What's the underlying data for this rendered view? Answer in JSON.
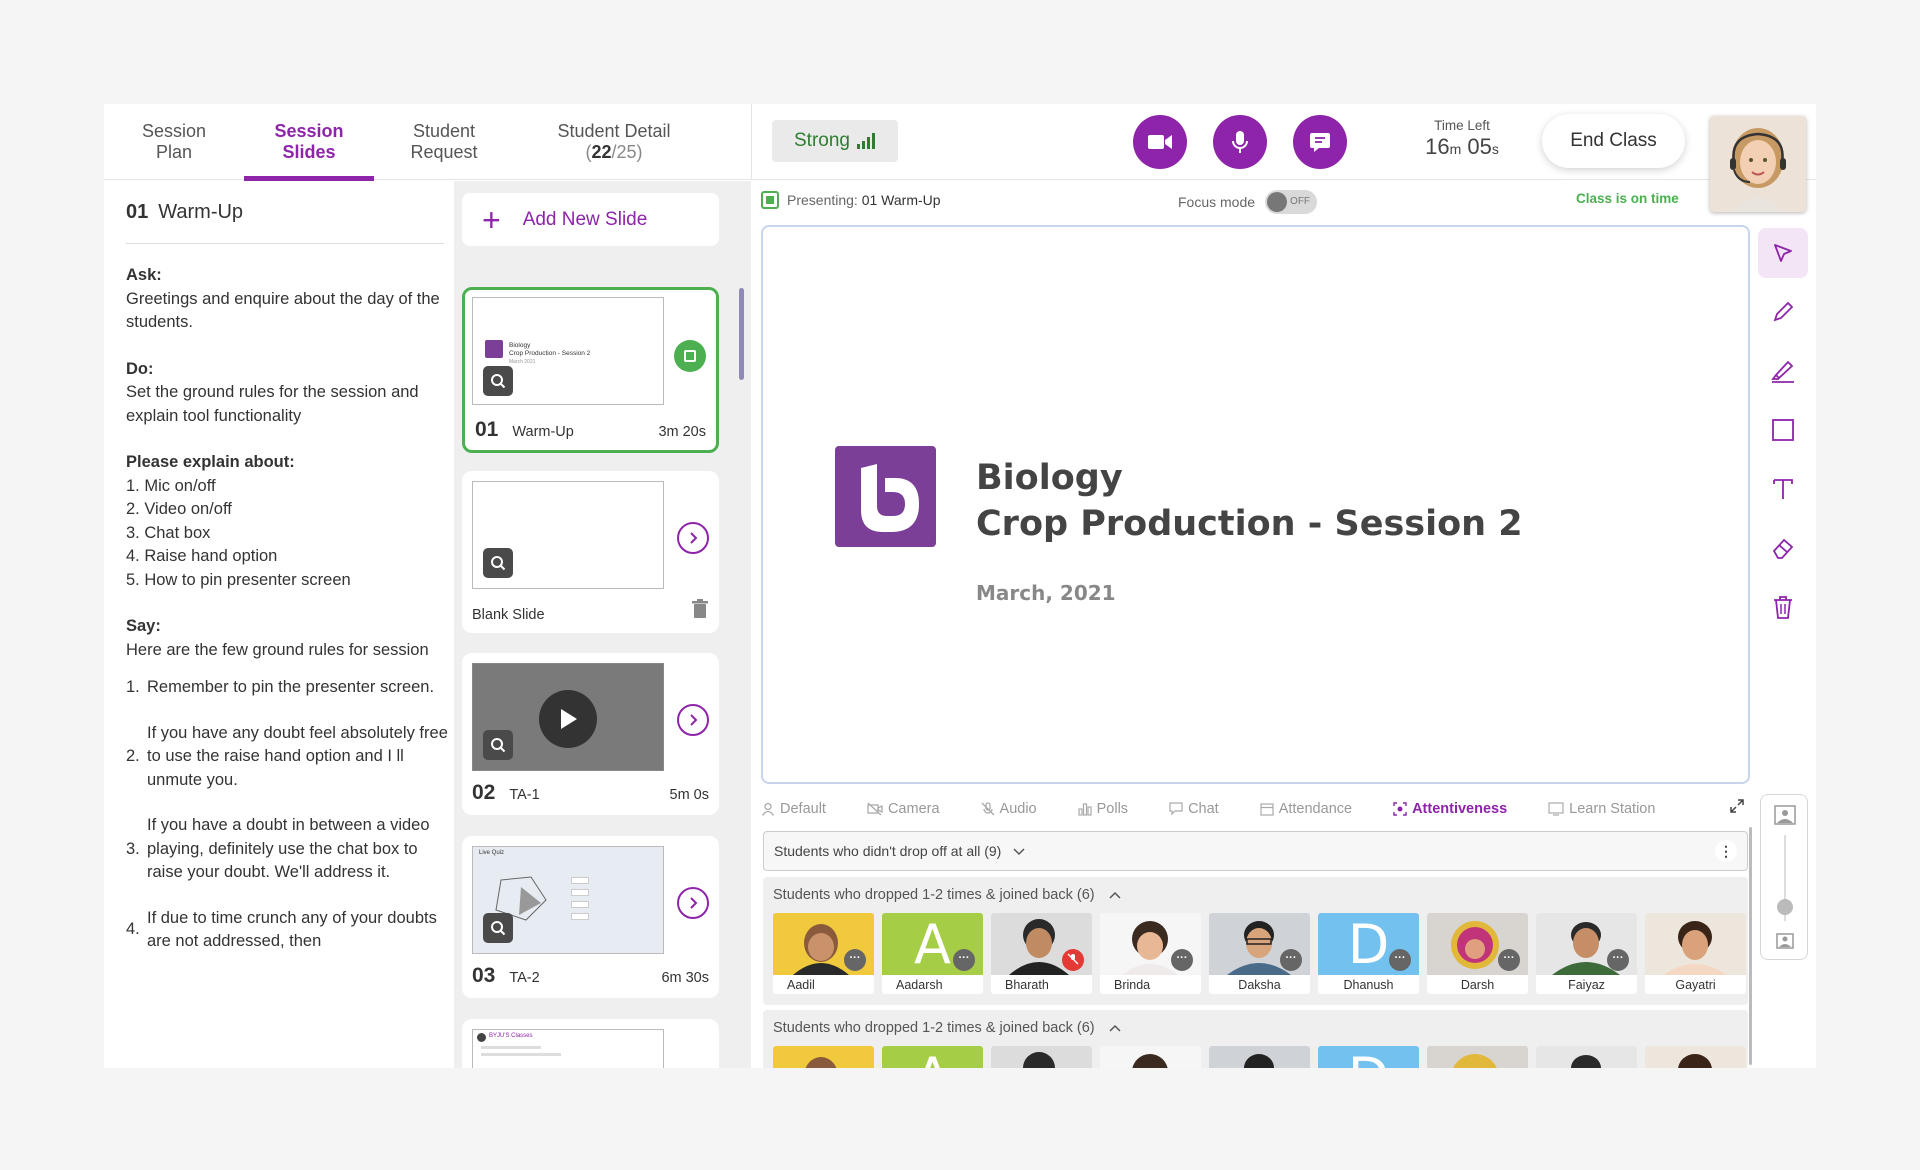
{
  "left_tabs": [
    {
      "line1": "Session",
      "line2": "Plan"
    },
    {
      "line1": "Session",
      "line2": "Slides"
    },
    {
      "line1": "Student",
      "line2": "Request"
    },
    {
      "line1": "Student Detail",
      "count_current": "22",
      "count_total": "/25)",
      "count_open": "("
    }
  ],
  "plan": {
    "number": "01",
    "title": "Warm-Up",
    "ask_heading": "Ask:",
    "ask_text": "Greetings and enquire about the day of the students.",
    "do_heading": "Do:",
    "do_text": "Set the ground rules for the session and explain tool functionality",
    "explain_heading": "Please explain about:",
    "explain_items": [
      "1. Mic on/off",
      "2. Video on/off",
      "3. Chat box",
      "4. Raise hand option",
      "5. How to pin presenter screen"
    ],
    "say_heading": "Say:",
    "say_text": "Here are the few ground rules for session",
    "rules": [
      {
        "n": "1.",
        "text": "Remember to pin the presenter screen."
      },
      {
        "n": "2.",
        "text": "If you have any doubt feel absolutely free to use the raise hand option and I ll unmute you."
      },
      {
        "n": "3.",
        "text": "If you have a doubt in between a video playing, definitely use the chat box to raise your doubt. We'll address it."
      },
      {
        "n": "4.",
        "text": "If due to time crunch any of your doubts are not addressed, then"
      }
    ]
  },
  "slides_panel": {
    "add_label": "Add New Slide",
    "cards": [
      {
        "num": "01",
        "name": "Warm-Up",
        "duration": "3m 20s",
        "thumb_line1": "Biology",
        "thumb_line2": "Crop Production - Session 2",
        "thumb_line3": "March 2021"
      },
      {
        "num": "",
        "name": "Blank Slide",
        "duration": ""
      },
      {
        "num": "02",
        "name": "TA-1",
        "duration": "5m 0s"
      },
      {
        "num": "03",
        "name": "TA-2",
        "duration": "6m 30s",
        "thumb_title": "Live Quiz"
      },
      {
        "num": "",
        "name": "",
        "duration": "",
        "thumb_title": "BYJU'S Classes"
      }
    ]
  },
  "topbar": {
    "signal_label": "Strong",
    "time_left_label": "Time Left",
    "time_min": "16",
    "time_min_unit": "m",
    "time_sec": "05",
    "time_sec_unit": "s",
    "end_label": "End Class"
  },
  "presenting": {
    "prefix": "Presenting:",
    "value": "01 Warm-Up",
    "focus_label": "Focus mode",
    "toggle_state": "OFF",
    "status": "Class is on time"
  },
  "slide": {
    "title_line1": "Biology",
    "title_line2": "Crop Production - Session 2",
    "date": "March, 2021"
  },
  "bottom_tabs": [
    "Default",
    "Camera",
    "Audio",
    "Polls",
    "Chat",
    "Attendance",
    "Attentiveness",
    "Learn Station"
  ],
  "groups": {
    "dropdown_label": "Students who didn't drop off at all (9)",
    "group1_label": "Students who dropped 1-2 times & joined back (6)",
    "group2_label": "Students who dropped 1-2 times & joined back (6)",
    "students": [
      "Aadil",
      "Aadarsh",
      "Bharath",
      "Brinda",
      "Daksha",
      "Dhanush",
      "Darsh",
      "Faiyaz",
      "Gayatri"
    ],
    "badge_dots": "···"
  },
  "colors": {
    "brand_purple": "#8e24aa",
    "success_green": "#4caf50",
    "letter_green": "#a5cd45",
    "letter_blue": "#72c1ef"
  }
}
